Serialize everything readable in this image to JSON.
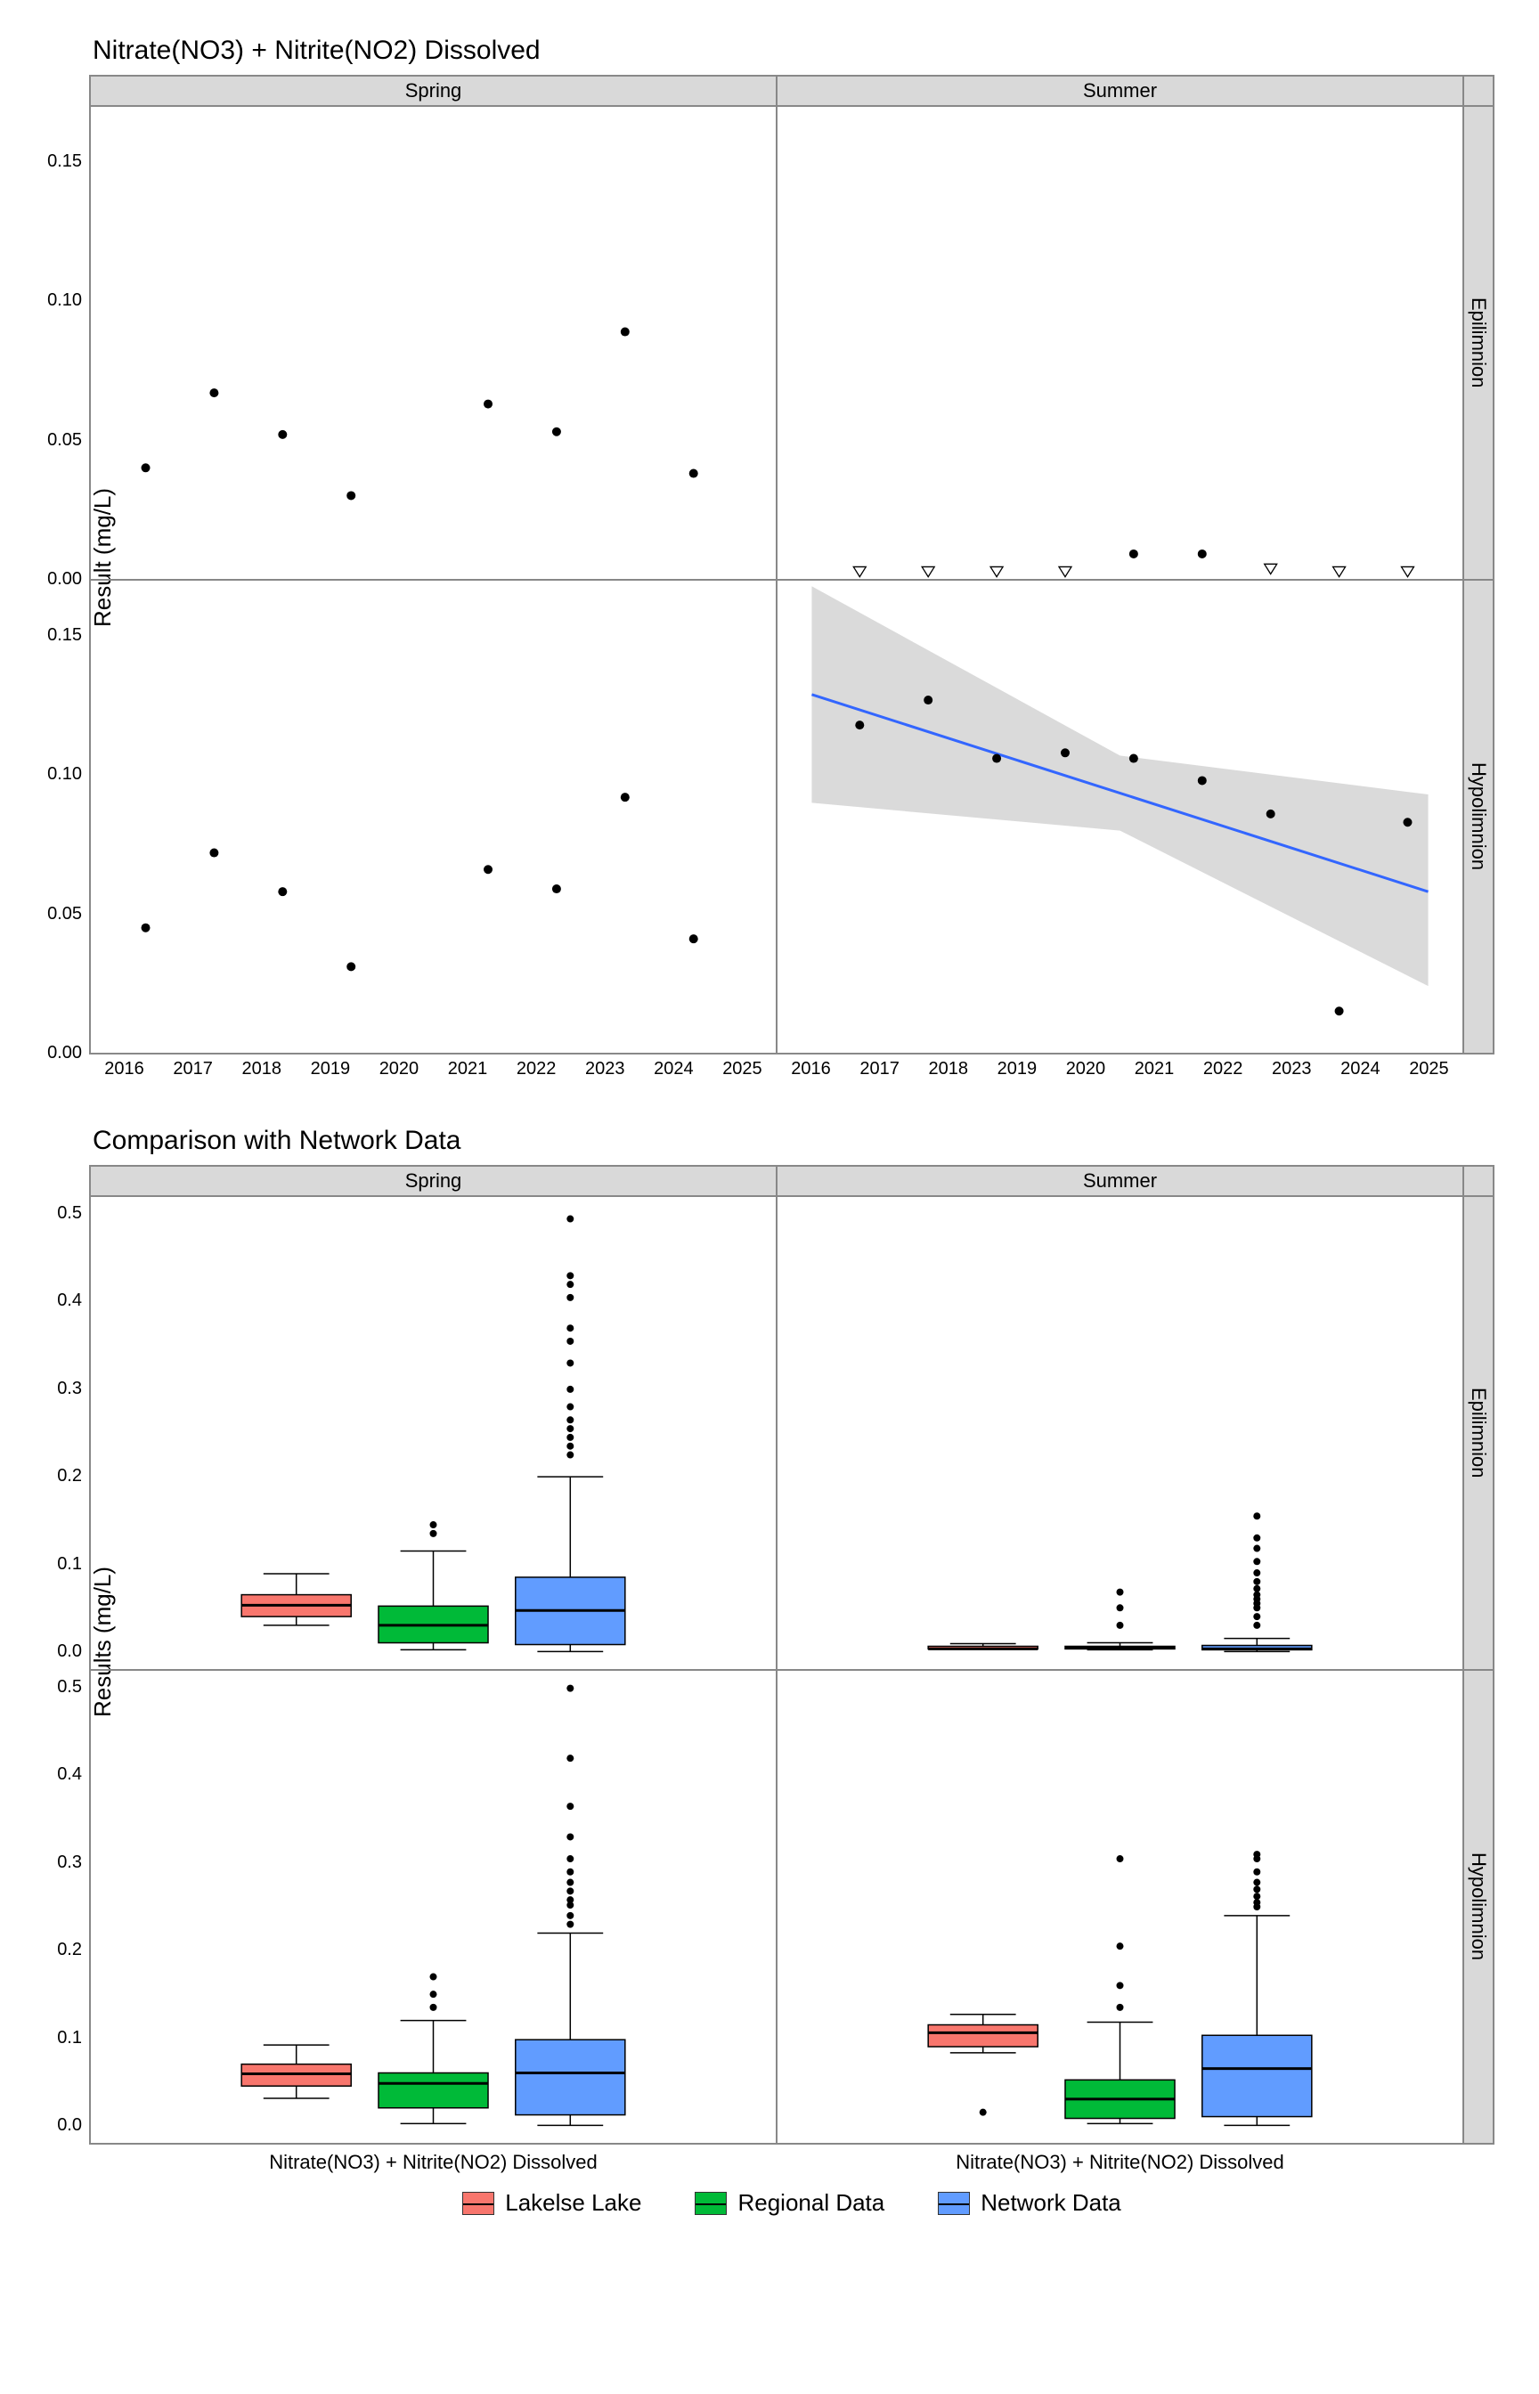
{
  "chart_data": [
    {
      "id": "scatter",
      "type": "scatter",
      "title": "Nitrate(NO3) + Nitrite(NO2) Dissolved",
      "ylabel": "Result (mg/L)",
      "ylim": [
        0,
        0.17
      ],
      "yticks": [
        0.0,
        0.05,
        0.1,
        0.15
      ],
      "ytick_labels": [
        "0.00",
        "0.05",
        "0.10",
        "0.15"
      ],
      "xlim": [
        2015.5,
        2025.5
      ],
      "xticks": [
        2016,
        2017,
        2018,
        2019,
        2020,
        2021,
        2022,
        2023,
        2024,
        2025
      ],
      "col_facets": [
        "Spring",
        "Summer"
      ],
      "row_facets": [
        "Epilimnion",
        "Hypolimnion"
      ],
      "panels": {
        "Spring|Epilimnion": {
          "points": [
            {
              "x": 2016.3,
              "y": 0.04
            },
            {
              "x": 2017.3,
              "y": 0.067
            },
            {
              "x": 2018.3,
              "y": 0.052
            },
            {
              "x": 2019.3,
              "y": 0.03
            },
            {
              "x": 2021.3,
              "y": 0.063
            },
            {
              "x": 2022.3,
              "y": 0.053
            },
            {
              "x": 2023.3,
              "y": 0.089
            },
            {
              "x": 2024.3,
              "y": 0.038
            }
          ],
          "open_points": [],
          "trend": null
        },
        "Summer|Epilimnion": {
          "points": [
            {
              "x": 2020.7,
              "y": 0.009
            },
            {
              "x": 2021.7,
              "y": 0.009
            }
          ],
          "open_points": [
            {
              "x": 2016.7,
              "y": 0.003
            },
            {
              "x": 2017.7,
              "y": 0.003
            },
            {
              "x": 2018.7,
              "y": 0.003
            },
            {
              "x": 2019.7,
              "y": 0.003
            },
            {
              "x": 2022.7,
              "y": 0.004
            },
            {
              "x": 2023.7,
              "y": 0.003
            },
            {
              "x": 2024.7,
              "y": 0.003
            }
          ],
          "trend": null
        },
        "Spring|Hypolimnion": {
          "points": [
            {
              "x": 2016.3,
              "y": 0.045
            },
            {
              "x": 2017.3,
              "y": 0.072
            },
            {
              "x": 2018.3,
              "y": 0.058
            },
            {
              "x": 2019.3,
              "y": 0.031
            },
            {
              "x": 2021.3,
              "y": 0.066
            },
            {
              "x": 2022.3,
              "y": 0.059
            },
            {
              "x": 2023.3,
              "y": 0.092
            },
            {
              "x": 2024.3,
              "y": 0.041
            }
          ],
          "open_points": [],
          "trend": null
        },
        "Summer|Hypolimnion": {
          "points": [
            {
              "x": 2016.7,
              "y": 0.118
            },
            {
              "x": 2017.7,
              "y": 0.127
            },
            {
              "x": 2018.7,
              "y": 0.106
            },
            {
              "x": 2019.7,
              "y": 0.108
            },
            {
              "x": 2020.7,
              "y": 0.106
            },
            {
              "x": 2021.7,
              "y": 0.098
            },
            {
              "x": 2022.7,
              "y": 0.086
            },
            {
              "x": 2023.7,
              "y": 0.015
            },
            {
              "x": 2024.7,
              "y": 0.083
            }
          ],
          "open_points": [],
          "trend": {
            "x1": 2016,
            "y1": 0.129,
            "x2": 2025,
            "y2": 0.058,
            "ribbon": [
              {
                "x": 2016,
                "lo": 0.09,
                "hi": 0.168
              },
              {
                "x": 2020.5,
                "lo": 0.08,
                "hi": 0.107
              },
              {
                "x": 2025,
                "lo": 0.024,
                "hi": 0.093
              }
            ]
          }
        }
      }
    },
    {
      "id": "boxplot",
      "type": "box",
      "title": "Comparison with Network Data",
      "ylabel": "Results (mg/L)",
      "ylim": [
        -0.02,
        0.52
      ],
      "yticks": [
        0.0,
        0.1,
        0.2,
        0.3,
        0.4,
        0.5
      ],
      "ytick_labels": [
        "0.0",
        "0.1",
        "0.2",
        "0.3",
        "0.4",
        "0.5"
      ],
      "x_category_label": "Nitrate(NO3) + Nitrite(NO2) Dissolved",
      "col_facets": [
        "Spring",
        "Summer"
      ],
      "row_facets": [
        "Epilimnion",
        "Hypolimnion"
      ],
      "series": [
        "Lakelse Lake",
        "Regional Data",
        "Network Data"
      ],
      "colors": {
        "Lakelse Lake": "#F8766D",
        "Regional Data": "#00BA38",
        "Network Data": "#619CFF"
      },
      "panels": {
        "Spring|Epilimnion": {
          "boxes": [
            {
              "series": "Lakelse Lake",
              "min": 0.03,
              "q1": 0.04,
              "med": 0.053,
              "q3": 0.065,
              "max": 0.089,
              "outliers": []
            },
            {
              "series": "Regional Data",
              "min": 0.002,
              "q1": 0.01,
              "med": 0.03,
              "q3": 0.052,
              "max": 0.115,
              "outliers": [
                0.135,
                0.145
              ]
            },
            {
              "series": "Network Data",
              "min": 0.0,
              "q1": 0.008,
              "med": 0.047,
              "q3": 0.085,
              "max": 0.2,
              "outliers": [
                0.225,
                0.235,
                0.245,
                0.255,
                0.265,
                0.28,
                0.3,
                0.33,
                0.355,
                0.37,
                0.405,
                0.42,
                0.43,
                0.495
              ]
            }
          ]
        },
        "Summer|Epilimnion": {
          "boxes": [
            {
              "series": "Lakelse Lake",
              "min": 0.003,
              "q1": 0.003,
              "med": 0.003,
              "q3": 0.006,
              "max": 0.009,
              "outliers": []
            },
            {
              "series": "Regional Data",
              "min": 0.002,
              "q1": 0.003,
              "med": 0.004,
              "q3": 0.006,
              "max": 0.01,
              "outliers": [
                0.03,
                0.05,
                0.068
              ]
            },
            {
              "series": "Network Data",
              "min": 0.0,
              "q1": 0.002,
              "med": 0.003,
              "q3": 0.007,
              "max": 0.015,
              "outliers": [
                0.03,
                0.04,
                0.05,
                0.055,
                0.06,
                0.065,
                0.072,
                0.08,
                0.09,
                0.103,
                0.118,
                0.13,
                0.155
              ]
            }
          ]
        },
        "Spring|Hypolimnion": {
          "boxes": [
            {
              "series": "Lakelse Lake",
              "min": 0.031,
              "q1": 0.045,
              "med": 0.059,
              "q3": 0.07,
              "max": 0.092,
              "outliers": []
            },
            {
              "series": "Regional Data",
              "min": 0.002,
              "q1": 0.02,
              "med": 0.048,
              "q3": 0.06,
              "max": 0.12,
              "outliers": [
                0.135,
                0.15,
                0.17
              ]
            },
            {
              "series": "Network Data",
              "min": 0.0,
              "q1": 0.012,
              "med": 0.06,
              "q3": 0.098,
              "max": 0.22,
              "outliers": [
                0.23,
                0.24,
                0.252,
                0.258,
                0.268,
                0.278,
                0.29,
                0.305,
                0.33,
                0.365,
                0.42,
                0.5
              ]
            }
          ]
        },
        "Summer|Hypolimnion": {
          "boxes": [
            {
              "series": "Lakelse Lake",
              "min": 0.083,
              "q1": 0.09,
              "med": 0.106,
              "q3": 0.115,
              "max": 0.127,
              "outliers": [
                0.015
              ]
            },
            {
              "series": "Regional Data",
              "min": 0.002,
              "q1": 0.008,
              "med": 0.03,
              "q3": 0.052,
              "max": 0.118,
              "outliers": [
                0.135,
                0.16,
                0.205,
                0.305
              ]
            },
            {
              "series": "Network Data",
              "min": 0.0,
              "q1": 0.01,
              "med": 0.065,
              "q3": 0.103,
              "max": 0.24,
              "outliers": [
                0.25,
                0.255,
                0.262,
                0.27,
                0.278,
                0.29,
                0.305,
                0.31
              ]
            }
          ]
        }
      }
    }
  ],
  "legend": {
    "items": [
      {
        "label": "Lakelse Lake",
        "color": "#F8766D"
      },
      {
        "label": "Regional Data",
        "color": "#00BA38"
      },
      {
        "label": "Network Data",
        "color": "#619CFF"
      }
    ]
  }
}
